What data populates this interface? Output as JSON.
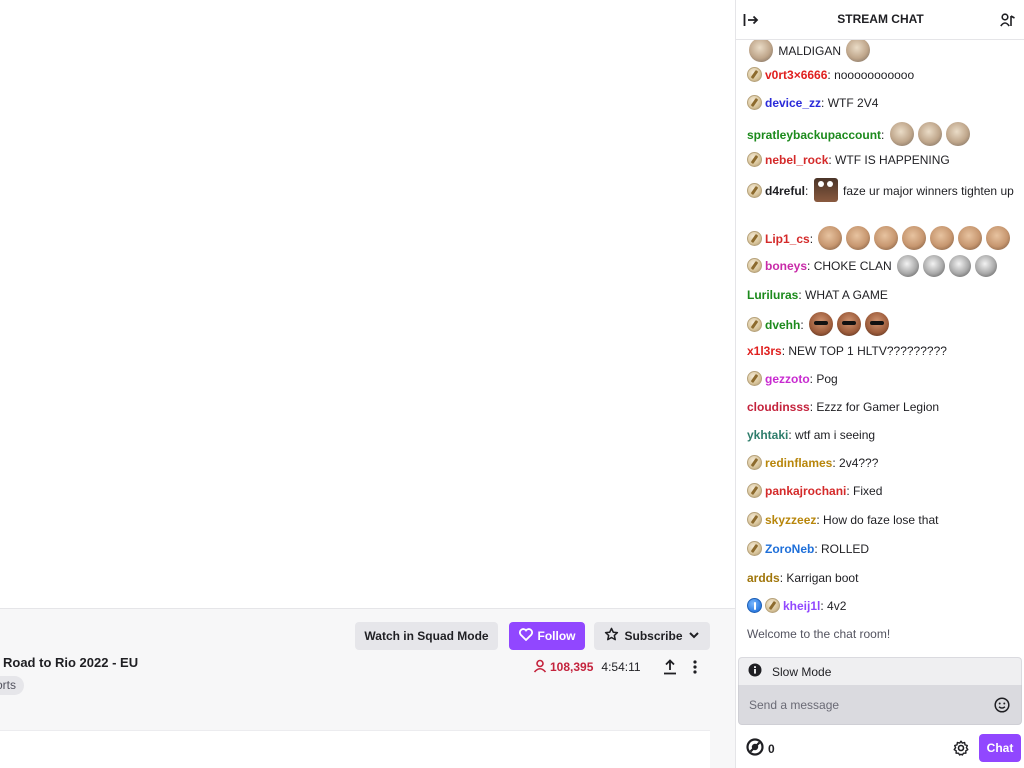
{
  "stream": {
    "title": "Road to Rio 2022 - EU",
    "category_tag": "orts",
    "viewer_count": "108,395",
    "uptime": "4:54:11"
  },
  "actions": {
    "squad_mode": "Watch in Squad Mode",
    "follow": "Follow",
    "subscribe": "Subscribe"
  },
  "chat": {
    "title": "STREAM CHAT",
    "messages": [
      {
        "user": "",
        "text": "MALDIGAN",
        "color": "#1f1f23",
        "badge": false
      },
      {
        "user": "v0rt3×6666",
        "text": "nooooooooooo",
        "color": "#e0201f",
        "badge": true
      },
      {
        "user": "device_zz",
        "text": "WTF 2V4",
        "color": "#2b2bd9",
        "badge": true
      },
      {
        "user": "spratleybackupaccount",
        "text": "",
        "color": "#1c8a1c",
        "badge": false
      },
      {
        "user": "nebel_rock",
        "text": "WTF IS HAPPENING",
        "color": "#d42a2a",
        "badge": true
      },
      {
        "user": "d4reful",
        "text": "faze ur major winners tighten up",
        "color": "#1f1f23",
        "badge": true
      },
      {
        "user": "Lip1_cs",
        "text": "",
        "color": "#d42a2a",
        "badge": true
      },
      {
        "user": "boneys",
        "text": "CHOKE CLAN",
        "color": "#c82ba8",
        "badge": true
      },
      {
        "user": "Luriluras",
        "text": "WHAT A GAME",
        "color": "#1c8a1c",
        "badge": false
      },
      {
        "user": "dvehh",
        "text": "",
        "color": "#1c8a1c",
        "badge": true
      },
      {
        "user": "x1l3rs",
        "text": "NEW TOP 1 HLTV?????????",
        "color": "#e0201f",
        "badge": false
      },
      {
        "user": "gezzoto",
        "text": "Pog",
        "color": "#c82bd0",
        "badge": true
      },
      {
        "user": "cloudinsss",
        "text": "Ezzz for Gamer Legion",
        "color": "#c4233d",
        "badge": false
      },
      {
        "user": "ykhtaki",
        "text": "wtf am i seeing",
        "color": "#2e7d6b",
        "badge": false
      },
      {
        "user": "redinflames",
        "text": "2v4???",
        "color": "#b8860b",
        "badge": true
      },
      {
        "user": "pankajrochani",
        "text": "Fixed",
        "color": "#d42a2a",
        "badge": true
      },
      {
        "user": "skyzzeez",
        "text": "How do faze lose that",
        "color": "#b8860b",
        "badge": true
      },
      {
        "user": "ZoroNeb",
        "text": "ROLLED",
        "color": "#1e6fd9",
        "badge": true
      },
      {
        "user": "ardds",
        "text": "Karrigan boot",
        "color": "#a0760b",
        "badge": false
      },
      {
        "user": "kheij1l",
        "text": "4v2",
        "color": "#9147ff",
        "badge": true
      }
    ],
    "welcome": "Welcome to the chat room!",
    "slow_mode": "Slow Mode",
    "input_placeholder": "Send a message",
    "points": "0",
    "chat_button": "Chat"
  },
  "colors": {
    "accent": "#9147ff",
    "viewer": "#c4233d"
  },
  "icons": [
    "collapse-arrow-icon",
    "users-icon",
    "heart-icon",
    "star-icon",
    "chevron-down-icon",
    "person-icon",
    "share-icon",
    "more-vertical-icon",
    "info-icon",
    "emote-smile-icon",
    "channel-points-icon",
    "gear-icon"
  ]
}
